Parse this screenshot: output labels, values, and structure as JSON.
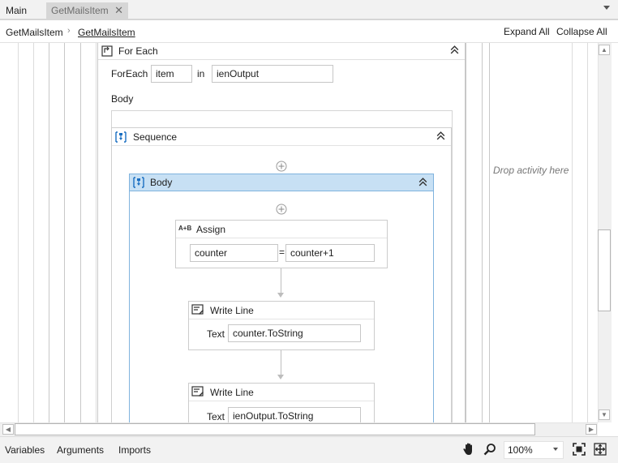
{
  "tabs": {
    "main": "Main",
    "active": "GetMailsItem",
    "close_glyph": "✕"
  },
  "breadcrumb": {
    "root": "GetMailsItem",
    "current": "GetMailsItem",
    "expand_all": "Expand All",
    "collapse_all": "Collapse All"
  },
  "foreach": {
    "title": "For Each",
    "foreach_label": "ForEach",
    "item_value": "item",
    "in_label": "in",
    "collection_value": "ienOutput",
    "body_label": "Body"
  },
  "sequence": {
    "title": "Sequence"
  },
  "body_seq": {
    "title": "Body"
  },
  "assign": {
    "title": "Assign",
    "icon_text": "A+B",
    "to_value": "counter",
    "equals": "=",
    "value": "counter+1"
  },
  "writeline1": {
    "title": "Write Line",
    "text_label": "Text",
    "text_value": "counter.ToString"
  },
  "writeline2": {
    "title": "Write Line",
    "text_label": "Text",
    "text_value": "ienOutput.ToString"
  },
  "drop_hint": "Drop activity here",
  "bottom": {
    "variables": "Variables",
    "arguments": "Arguments",
    "imports": "Imports",
    "zoom": "100%"
  },
  "colors": {
    "selected_header": "#c7e0f4",
    "selected_border": "#80b3de",
    "icon_blue": "#1a6fc2"
  }
}
